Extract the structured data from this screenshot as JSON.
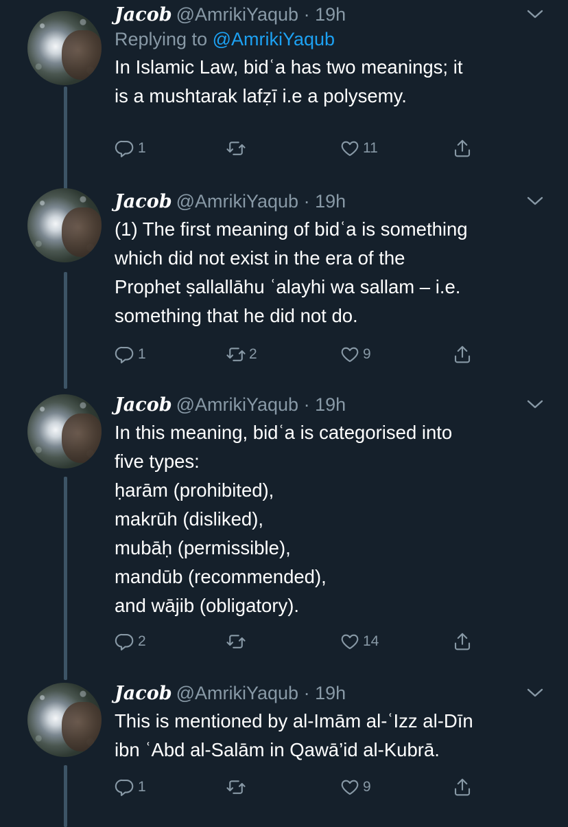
{
  "tweets": [
    {
      "name": "Jacob",
      "handle": "@AmrikiYaqub",
      "time": "· 19h",
      "replying_prefix": "Replying to",
      "replying_handle": "@AmrikiYaqub",
      "lines": [
        "In Islamic Law, bidʿa has two meanings; it",
        "is a mushtarak lafẓī i.e a polysemy."
      ],
      "replies": "1",
      "retweets": "",
      "likes": "11"
    },
    {
      "name": "Jacob",
      "handle": "@AmrikiYaqub",
      "time": "· 19h",
      "lines": [
        "(1) The first meaning of bidʿa is something",
        "which did not exist in the era of the",
        "Prophet ṣallallāhu ʿalayhi wa sallam – i.e.",
        "something that he did not do."
      ],
      "replies": "1",
      "retweets": "2",
      "likes": "9"
    },
    {
      "name": "Jacob",
      "handle": "@AmrikiYaqub",
      "time": "· 19h",
      "lines": [
        "In this meaning, bidʿa is categorised into",
        "five types:",
        "ḥarām (prohibited),",
        "makrūh (disliked),",
        "mubāḥ (permissible),",
        "mandūb (recommended),",
        "and wājib (obligatory)."
      ],
      "replies": "2",
      "retweets": "",
      "likes": "14"
    },
    {
      "name": "Jacob",
      "handle": "@AmrikiYaqub",
      "time": "· 19h",
      "lines": [
        "This is mentioned by al-Imām al-ʿIzz al-Dīn",
        "ibn ʿAbd al-Salām in Qawā’id al-Kubrā."
      ],
      "replies": "1",
      "retweets": "",
      "likes": "9"
    }
  ],
  "colors": {
    "background": "#15202b",
    "muted": "#8899a6",
    "link": "#1da1f2",
    "thread_line": "#3d5466"
  },
  "icons": {
    "reply": "reply-icon",
    "retweet": "retweet-icon",
    "like": "heart-icon",
    "share": "share-icon",
    "more": "chevron-down-icon"
  }
}
